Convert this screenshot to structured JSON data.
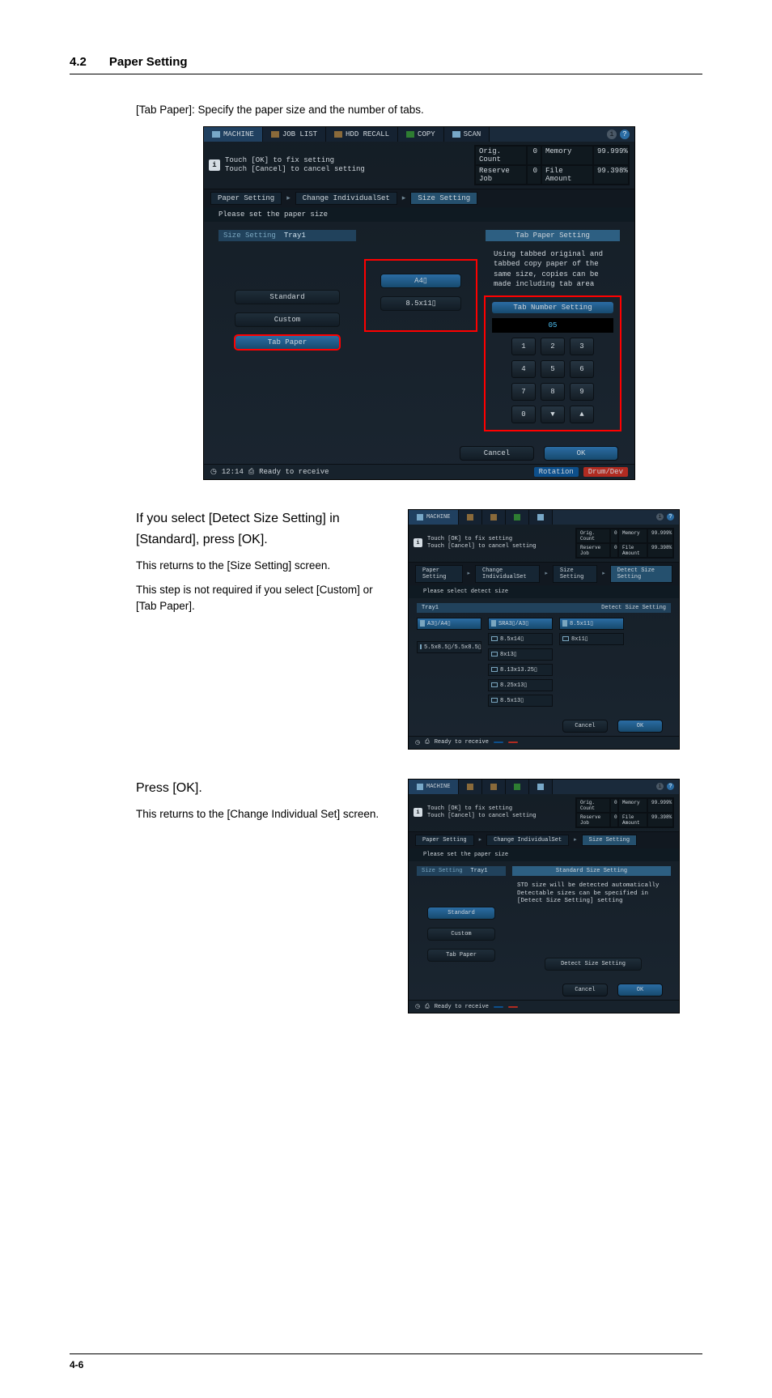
{
  "page": {
    "section_number": "4.2",
    "section_title": "Paper Setting",
    "page_number": "4-6"
  },
  "intro_text": "[Tab Paper]: Specify the paper size and the number of tabs.",
  "step2": {
    "title1": "If you select [Detect Size Setting] in",
    "title2": "[Standard], press [OK].",
    "note1": "This returns to the [Size Setting] screen.",
    "note2": "This step is not required if you select [Custom] or [Tab Paper]."
  },
  "step3": {
    "title": "Press [OK].",
    "note": "This returns to the [Change Individual Set] screen."
  },
  "ui": {
    "tabs": {
      "machine": "MACHINE",
      "joblist": "JOB LIST",
      "hdd": "HDD RECALL",
      "copy": "COPY",
      "scan": "SCAN"
    },
    "info_l1": "Touch [OK] to fix setting",
    "info_l2": "Touch [Cancel] to cancel setting",
    "status": {
      "orig_count_l": "Orig. Count",
      "orig_count_v": "0",
      "reserve_l": "Reserve Job",
      "reserve_v": "0",
      "memory_l": "Memory",
      "memory_v": "99.999%",
      "file_l": "File Amount",
      "file_v": "99.398%"
    },
    "crumb1": "Paper Setting",
    "crumb2": "Change IndividualSet",
    "crumb3": "Size Setting",
    "crumb3b": "Detect Size Setting",
    "prompt": "Please set the paper size",
    "prompt2": "Please select detect size",
    "size_setting": "Size Setting",
    "tray": "Tray1",
    "standard": "Standard",
    "custom": "Custom",
    "tabpaper": "Tab Paper",
    "tab_paper_setting": "Tab Paper Setting",
    "detect_size_setting": "Detect Size Setting",
    "standard_size_setting": "Standard Size Setting",
    "detect_btn": "Detect Size Setting",
    "desc_tab": "Using tabbed original and tabbed copy paper of the same size, copies can be made including tab area",
    "desc_std": "STD size will be detected automatically Detectable sizes can be specified in [Detect Size Setting] setting",
    "a4": "A4▯",
    "s85x11": "8.5x11▯",
    "keypad_title": "Tab Number Setting",
    "keypad_disp": "05",
    "keys": [
      "1",
      "2",
      "3",
      "4",
      "5",
      "6",
      "7",
      "8",
      "9",
      "0",
      "▼",
      "▲"
    ],
    "cancel": "Cancel",
    "ok": "OK",
    "clock": "12:14",
    "ready": "Ready to receive",
    "rotation": "Rotation",
    "drumdev": "Drum/Dev",
    "sizes_col1": [
      "A3▯/A4▯",
      "5.5x8.5▯/5.5x8.5▯"
    ],
    "sizes_col2": [
      "SRA3▯/A3▯",
      "8.5x14▯",
      "8x13▯",
      "8.13x13.25▯",
      "8.25x13▯",
      "8.5x13▯"
    ],
    "sizes_col3": [
      "8.5x11▯",
      "8x11▯"
    ]
  }
}
